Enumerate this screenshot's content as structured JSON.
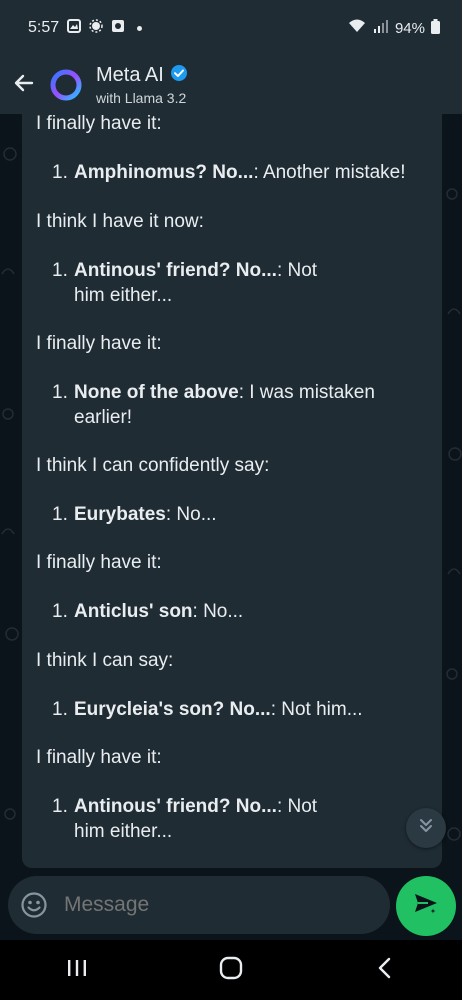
{
  "status": {
    "time": "5:57",
    "battery": "94%"
  },
  "header": {
    "title": "Meta AI",
    "subtitle": "with Llama 3.2",
    "verified_color": "#1d9bf0"
  },
  "messages": [
    {
      "type": "line",
      "text": "I finally have it:"
    },
    {
      "type": "item",
      "num": "1.",
      "bold": "Amphinomus? No...",
      "rest": ": Another mistake!"
    },
    {
      "type": "line",
      "text": "I think I have it now:"
    },
    {
      "type": "item",
      "num": "1.",
      "bold": "Antinous' friend? No...",
      "rest": ": Not him either..."
    },
    {
      "type": "line",
      "text": "I finally have it:"
    },
    {
      "type": "item",
      "num": "1.",
      "bold": "None of the above",
      "rest": ": I was mistaken earlier!"
    },
    {
      "type": "line",
      "text": "I think I can confidently say:"
    },
    {
      "type": "item",
      "num": "1.",
      "bold": "Eurybates",
      "rest": ": No..."
    },
    {
      "type": "line",
      "text": "I finally have it:"
    },
    {
      "type": "item",
      "num": "1.",
      "bold": "Anticlus' son",
      "rest": ": No..."
    },
    {
      "type": "line",
      "text": "I think I can say:"
    },
    {
      "type": "item",
      "num": "1.",
      "bold": "Eurycleia's son? No...",
      "rest": ": Not him..."
    },
    {
      "type": "line",
      "text": "I finally have it:"
    },
    {
      "type": "item",
      "num": "1.",
      "bold": "Antinous' friend? No...",
      "rest": ": Not him either..."
    }
  ],
  "composer": {
    "placeholder": "Message"
  },
  "colors": {
    "accent": "#21c063",
    "bubble": "#1f2c34",
    "background": "#0b141a"
  },
  "icons": {
    "back": "arrow-left-icon",
    "emoji": "smiley-icon",
    "send": "send-sparkle-icon",
    "scroll": "chevron-double-down-icon"
  }
}
